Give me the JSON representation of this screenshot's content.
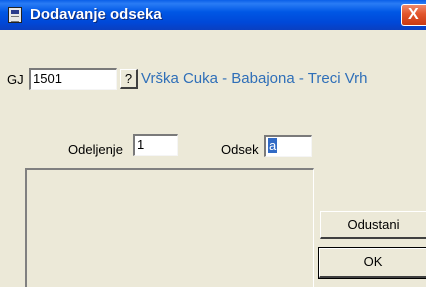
{
  "window": {
    "title": "Dodavanje odseka",
    "close_glyph": "X",
    "icon": "form-window-icon"
  },
  "form": {
    "gj_label": "GJ",
    "gj_value": "1501",
    "lookup_button": "?",
    "gj_name": "Vrška Cuka - Babajona - Treci Vrh",
    "odeljenje_label": "Odeljenje",
    "odeljenje_value": "1",
    "odsek_label": "Odsek",
    "odsek_value": "a"
  },
  "buttons": {
    "cancel": "Odustani",
    "ok": "OK"
  },
  "colors": {
    "titlebar": "#0054e3",
    "window_bg": "#ece9d8",
    "link_text": "#2f6fb8",
    "selection": "#316ac5",
    "close": "#e2552b"
  }
}
